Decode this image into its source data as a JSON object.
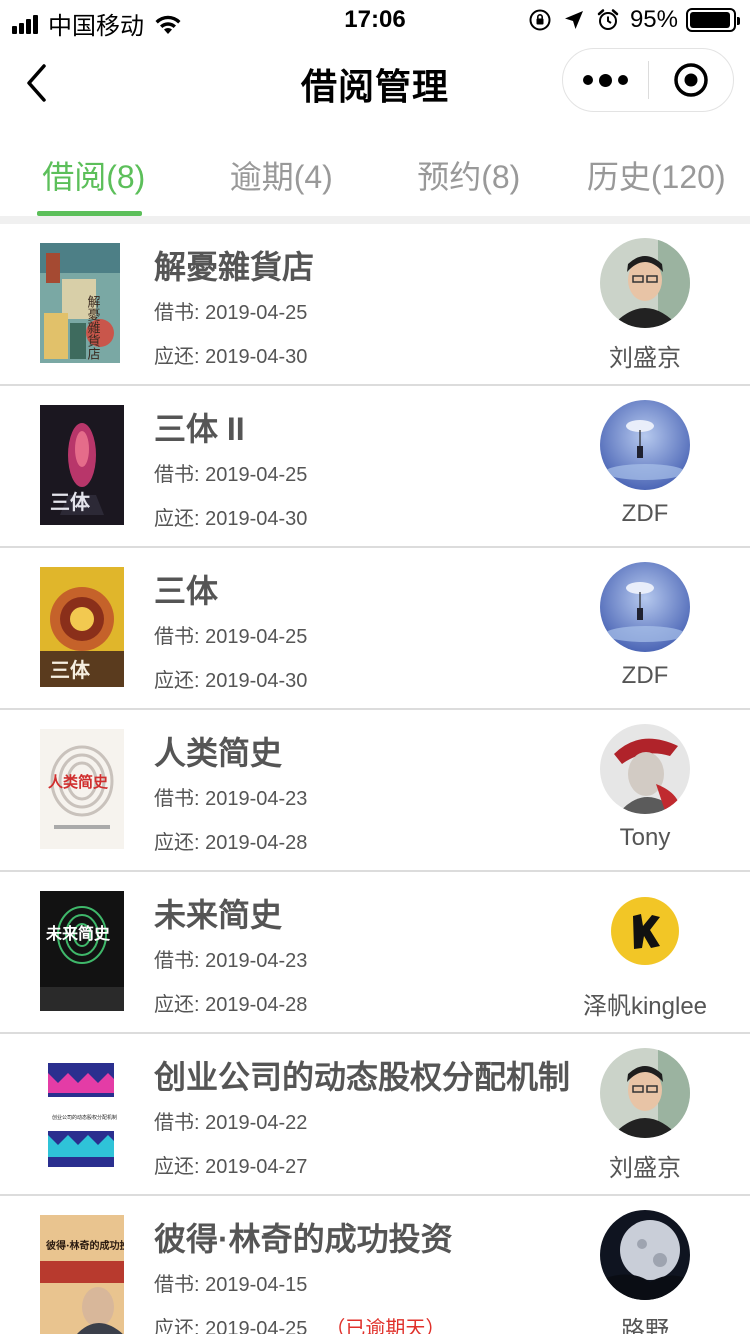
{
  "status_bar": {
    "carrier": "中国移动",
    "time": "17:06",
    "battery_percent": "95%",
    "battery_level": 0.95
  },
  "nav": {
    "title": "借阅管理"
  },
  "tabs": [
    {
      "label": "借阅(8)",
      "active": true
    },
    {
      "label": "逾期(4)",
      "active": false
    },
    {
      "label": "预约(8)",
      "active": false
    },
    {
      "label": "历史(120)",
      "active": false
    }
  ],
  "colors": {
    "accent": "#5cbf5a",
    "overdue": "#e0312b"
  },
  "records": [
    {
      "title": "解憂雜貨店",
      "borrow": "借书: 2019-04-25",
      "due": "应还: 2019-04-30",
      "overdue": "",
      "user": "刘盛京",
      "cover_text": "解憂雜貨店"
    },
    {
      "title": "三体 II",
      "borrow": "借书: 2019-04-25",
      "due": "应还: 2019-04-30",
      "overdue": "",
      "user": "ZDF",
      "cover_text": "三体"
    },
    {
      "title": "三体",
      "borrow": "借书: 2019-04-25",
      "due": "应还: 2019-04-30",
      "overdue": "",
      "user": "ZDF",
      "cover_text": "三体"
    },
    {
      "title": "人类简史",
      "borrow": "借书: 2019-04-23",
      "due": "应还: 2019-04-28",
      "overdue": "",
      "user": "Tony",
      "cover_text": "人类简史"
    },
    {
      "title": "未来简史",
      "borrow": "借书: 2019-04-23",
      "due": "应还: 2019-04-28",
      "overdue": "",
      "user": "泽帆kinglee",
      "cover_text": "未来简史"
    },
    {
      "title": "创业公司的动态股权分配机制",
      "borrow": "借书: 2019-04-22",
      "due": "应还: 2019-04-27",
      "overdue": "",
      "user": "刘盛京",
      "cover_text": "创业公司的动态股权分配机制"
    },
    {
      "title": "彼得·林奇的成功投资",
      "borrow": "借书: 2019-04-15",
      "due": "应还: 2019-04-25",
      "overdue": "（已逾期天）",
      "user": "路野",
      "cover_text": "彼得·林奇的成功投资"
    }
  ]
}
